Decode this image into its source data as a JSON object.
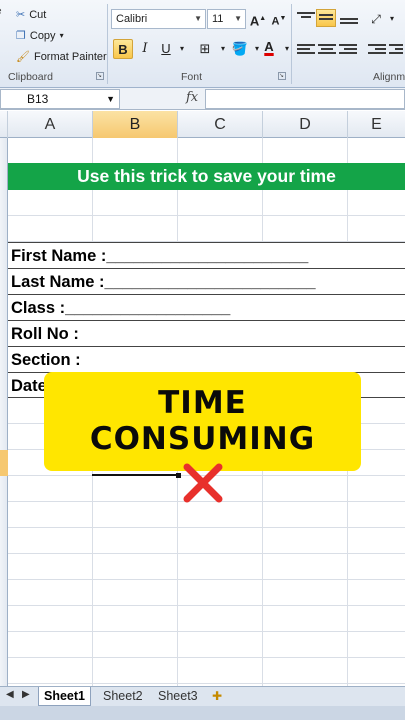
{
  "ribbon": {
    "clipboard": {
      "cut": "Cut",
      "copy": "Copy",
      "format_painter": "Format Painter",
      "label": "Clipboard"
    },
    "font": {
      "name": "Calibri",
      "size": "11",
      "bold": "B",
      "italic": "I",
      "underline": "U",
      "label": "Font"
    },
    "alignment": {
      "label": "Alignm"
    }
  },
  "formula_bar": {
    "name_box": "B13",
    "fx": "fx",
    "formula": ""
  },
  "columns": [
    "A",
    "B",
    "C",
    "D",
    "E"
  ],
  "selected_column": "B",
  "sheet": {
    "banner": "Use this trick to save your time",
    "rows": [
      "First Name :______________________",
      "Last Name :_______________________",
      "Class :__________________",
      "Roll No :",
      "Section :",
      "Date"
    ]
  },
  "overlay": {
    "title": "TIME CONSUMING"
  },
  "tabs": [
    "Sheet1",
    "Sheet2",
    "Sheet3"
  ],
  "active_tab": "Sheet1",
  "colors": {
    "banner": "#14a448",
    "overlay": "#ffe600",
    "cross": "#e8302b",
    "selected_header": "#f6c870"
  }
}
